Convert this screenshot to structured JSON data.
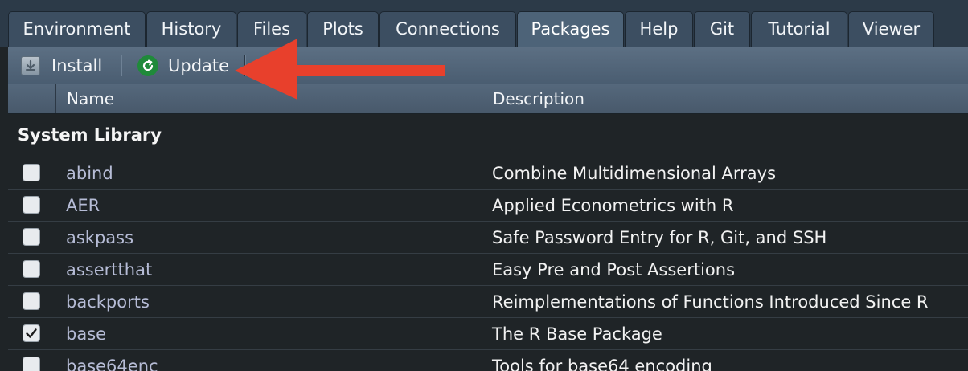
{
  "tabs": [
    {
      "label": "Environment",
      "active": false
    },
    {
      "label": "History",
      "active": false
    },
    {
      "label": "Files",
      "active": false
    },
    {
      "label": "Plots",
      "active": false
    },
    {
      "label": "Connections",
      "active": false
    },
    {
      "label": "Packages",
      "active": true
    },
    {
      "label": "Help",
      "active": false
    },
    {
      "label": "Git",
      "active": false
    },
    {
      "label": "Tutorial",
      "active": false
    },
    {
      "label": "Viewer",
      "active": false
    }
  ],
  "toolbar": {
    "install_label": "Install",
    "update_label": "Update",
    "install_icon": "install-icon",
    "update_icon": "refresh-icon",
    "update_icon_color": "#1f8a3a"
  },
  "table": {
    "headers": {
      "name": "Name",
      "description": "Description"
    },
    "section": "System Library",
    "rows": [
      {
        "name": "abind",
        "description": "Combine Multidimensional Arrays",
        "checked": false
      },
      {
        "name": "AER",
        "description": "Applied Econometrics with R",
        "checked": false
      },
      {
        "name": "askpass",
        "description": "Safe Password Entry for R, Git, and SSH",
        "checked": false
      },
      {
        "name": "assertthat",
        "description": "Easy Pre and Post Assertions",
        "checked": false
      },
      {
        "name": "backports",
        "description": "Reimplementations of Functions Introduced Since R",
        "checked": false
      },
      {
        "name": "base",
        "description": "The R Base Package",
        "checked": true
      },
      {
        "name": "base64enc",
        "description": "Tools for base64 encoding",
        "checked": false
      }
    ]
  },
  "annotation": {
    "arrow_color": "#e8402c",
    "arrow_icon": "arrow-left-icon"
  }
}
